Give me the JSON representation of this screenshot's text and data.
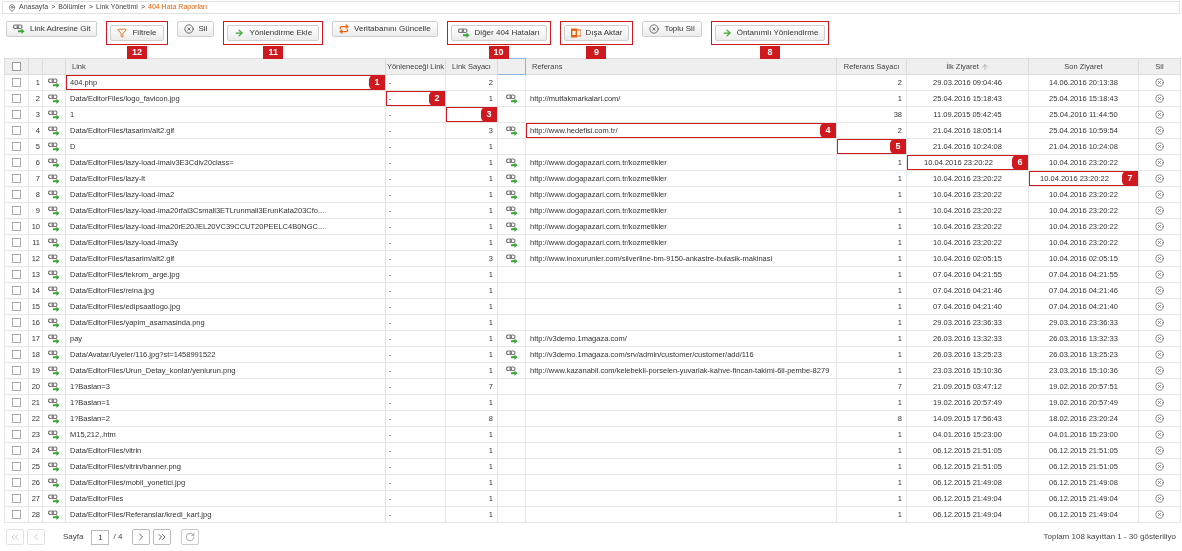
{
  "breadcrumb": {
    "separator": ">",
    "items": [
      {
        "label": "Anasayfa",
        "current": false
      },
      {
        "label": "Bölümler",
        "current": false
      },
      {
        "label": "Link Yönetimi",
        "current": false
      },
      {
        "label": "404 Hata Raporları",
        "current": true
      }
    ]
  },
  "toolbar": [
    {
      "label": "Link Adresine Git",
      "kind": "link"
    },
    {
      "label": "Filtrele",
      "kind": "filter",
      "callout": "12"
    },
    {
      "label": "Sil",
      "kind": "delete"
    },
    {
      "label": "Yönlendirme Ekle",
      "kind": "arrow",
      "callout": "11"
    },
    {
      "label": "Veritabanını Güncelle",
      "kind": "sync"
    },
    {
      "label": "Diğer 404 Hataları",
      "kind": "link",
      "callout": "10"
    },
    {
      "label": "Dışa Aktar",
      "kind": "office",
      "callout": "9"
    },
    {
      "label": "Toplu Sil",
      "kind": "delete"
    },
    {
      "label": "Öntanımlı Yönlendirme",
      "kind": "arrow",
      "callout": "8"
    }
  ],
  "table": {
    "header_checked": false,
    "columns": [
      {
        "label": "Link",
        "sorted": false
      },
      {
        "label": "Yönleneceği Link",
        "sorted": false
      },
      {
        "label": "Link Sayacı",
        "sorted": false
      },
      {
        "label": "Referans",
        "sorted": false
      },
      {
        "label": "Referans Sayacı",
        "sorted": false
      },
      {
        "label": "İlk Ziyaret",
        "sorted": true
      },
      {
        "label": "Son Ziyaret",
        "sorted": false
      },
      {
        "label": "Sil",
        "sorted": false
      }
    ],
    "rows": [
      {
        "n": "1",
        "checked": false,
        "link": "404.php",
        "redirect": "-",
        "count": "2",
        "ref_icon": false,
        "referer": "",
        "ref_count": "2",
        "first_visit": "29.03.2016 09:04:46",
        "last_visit": "14.06.2016 20:13:38",
        "link_callout": "1"
      },
      {
        "n": "2",
        "checked": false,
        "link": "Data/EditorFiles/logo_favicon.jpg",
        "redirect": "-",
        "count": "1",
        "ref_icon": true,
        "referer": "http://mutfakmarkalari.com/",
        "ref_count": "1",
        "first_visit": "25.04.2016 15:18:43",
        "last_visit": "25.04.2016 15:18:43",
        "redirect_callout": "2"
      },
      {
        "n": "3",
        "checked": false,
        "link": "1",
        "redirect": "-",
        "count": "",
        "ref_icon": false,
        "referer": "",
        "ref_count": "38",
        "first_visit": "11.09.2015 05:42:45",
        "last_visit": "25.04.2016 11:44:50",
        "count_callout": "3"
      },
      {
        "n": "4",
        "checked": false,
        "link": "Data/EditorFiles/tasarim/alt2.gif",
        "redirect": "-",
        "count": "3",
        "ref_icon": true,
        "referer": "http://www.hedefisi.com.tr/",
        "ref_count": "2",
        "first_visit": "21.04.2016 18:05:14",
        "last_visit": "25.04.2016 10:59:54",
        "referer_callout": "4"
      },
      {
        "n": "5",
        "checked": false,
        "link": "D",
        "redirect": "-",
        "count": "1",
        "ref_icon": false,
        "referer": "",
        "ref_count": "",
        "first_visit": "21.04.2016 10:24:08",
        "last_visit": "21.04.2016 10:24:08",
        "ref_count_callout": "5"
      },
      {
        "n": "6",
        "checked": false,
        "link": "Data/EditorFiles/lazy-load-imaiv3E3Cdiv20class=",
        "redirect": "-",
        "count": "1",
        "ref_icon": true,
        "referer": "http://www.dogapazari.com.tr/kozmetikler",
        "ref_count": "1",
        "first_visit": "10.04.2016 23:20:22",
        "last_visit": "10.04.2016 23:20:22",
        "first_visit_callout": "6"
      },
      {
        "n": "7",
        "checked": false,
        "link": "Data/EditorFiles/lazy-lt",
        "redirect": "-",
        "count": "1",
        "ref_icon": true,
        "referer": "http://www.dogapazari.com.tr/kozmetikler",
        "ref_count": "1",
        "first_visit": "10.04.2016 23:20:22",
        "last_visit": "10.04.2016 23:20:22",
        "last_visit_callout": "7"
      },
      {
        "n": "8",
        "checked": false,
        "link": "Data/EditorFiles/lazy-load-ima2",
        "redirect": "-",
        "count": "1",
        "ref_icon": true,
        "referer": "http://www.dogapazari.com.tr/kozmetikler",
        "ref_count": "1",
        "first_visit": "10.04.2016 23:20:22",
        "last_visit": "10.04.2016 23:20:22"
      },
      {
        "n": "9",
        "checked": false,
        "link": "Data/EditorFiles/lazy-load-ima20rfal3Csmall3ETLrunmall3ErunKata203Cfo...",
        "redirect": "-",
        "count": "1",
        "ref_icon": true,
        "referer": "http://www.dogapazari.com.tr/kozmetikler",
        "ref_count": "1",
        "first_visit": "10.04.2016 23:20:22",
        "last_visit": "10.04.2016 23:20:22"
      },
      {
        "n": "10",
        "checked": false,
        "link": "Data/EditorFiles/lazy-load-ima20rE20JEL20VC39CCUT20PEELC4B0NGC...",
        "redirect": "-",
        "count": "1",
        "ref_icon": true,
        "referer": "http://www.dogapazari.com.tr/kozmetikler",
        "ref_count": "1",
        "first_visit": "10.04.2016 23:20:22",
        "last_visit": "10.04.2016 23:20:22"
      },
      {
        "n": "11",
        "checked": false,
        "link": "Data/EditorFiles/lazy-load-ima3y",
        "redirect": "-",
        "count": "1",
        "ref_icon": true,
        "referer": "http://www.dogapazari.com.tr/kozmetikler",
        "ref_count": "1",
        "first_visit": "10.04.2016 23:20:22",
        "last_visit": "10.04.2016 23:20:22"
      },
      {
        "n": "12",
        "checked": false,
        "link": "Data/EditorFiles/tasarim/alt2.gif",
        "redirect": "-",
        "count": "3",
        "ref_icon": true,
        "referer": "http://www.inoxurunler.com/silverline-bm-9150-ankastre-bulasik-makinasi",
        "ref_count": "1",
        "first_visit": "10.04.2016 02:05:15",
        "last_visit": "10.04.2016 02:05:15"
      },
      {
        "n": "13",
        "checked": false,
        "link": "Data/EditorFiles/tekrom_arge.jpg",
        "redirect": "-",
        "count": "1",
        "ref_icon": false,
        "referer": "",
        "ref_count": "1",
        "first_visit": "07.04.2016 04:21:55",
        "last_visit": "07.04.2016 04:21:55"
      },
      {
        "n": "14",
        "checked": false,
        "link": "Data/EditorFiles/reina.jpg",
        "redirect": "-",
        "count": "1",
        "ref_icon": false,
        "referer": "",
        "ref_count": "1",
        "first_visit": "07.04.2016 04:21:46",
        "last_visit": "07.04.2016 04:21:46"
      },
      {
        "n": "15",
        "checked": false,
        "link": "Data/EditorFiles/edipsaatlogo.jpg",
        "redirect": "-",
        "count": "1",
        "ref_icon": false,
        "referer": "",
        "ref_count": "1",
        "first_visit": "07.04.2016 04:21:40",
        "last_visit": "07.04.2016 04:21:40"
      },
      {
        "n": "16",
        "checked": false,
        "link": "Data/EditorFiles/yapim_asamasinda.png",
        "redirect": "-",
        "count": "1",
        "ref_icon": false,
        "referer": "",
        "ref_count": "1",
        "first_visit": "29.03.2016 23:36:33",
        "last_visit": "29.03.2016 23:36:33"
      },
      {
        "n": "17",
        "checked": false,
        "link": "pay",
        "redirect": "-",
        "count": "1",
        "ref_icon": true,
        "referer": "http://v3demo.1magaza.com/",
        "ref_count": "1",
        "first_visit": "26.03.2016 13:32:33",
        "last_visit": "26.03.2016 13:32:33"
      },
      {
        "n": "18",
        "checked": false,
        "link": "Data/Avatar/Uyeler/116.jpg?st=1458991522",
        "redirect": "-",
        "count": "1",
        "ref_icon": true,
        "referer": "http://v3demo.1magaza.com/srv/admin/customer/customer/add/116",
        "ref_count": "1",
        "first_visit": "26.03.2016 13:25:23",
        "last_visit": "26.03.2016 13:25:23"
      },
      {
        "n": "19",
        "checked": false,
        "link": "Data/EditorFiles/Urun_Detay_konlar/yeniurun.png",
        "redirect": "-",
        "count": "1",
        "ref_icon": true,
        "referer": "http://www.kazanabil.com/kelebekli-porselen-yuvarlak-kahve-fincan-takimi-6li-pembe-8279",
        "ref_count": "1",
        "first_visit": "23.03.2016 15:10:36",
        "last_visit": "23.03.2016 15:10:36"
      },
      {
        "n": "20",
        "checked": false,
        "link": "1?Baslan=3",
        "redirect": "-",
        "count": "7",
        "ref_icon": false,
        "referer": "",
        "ref_count": "7",
        "first_visit": "21.09.2015 03:47:12",
        "last_visit": "19.02.2016 20:57:51"
      },
      {
        "n": "21",
        "checked": false,
        "link": "1?Baslan=1",
        "redirect": "-",
        "count": "1",
        "ref_icon": false,
        "referer": "",
        "ref_count": "1",
        "first_visit": "19.02.2016 20:57:49",
        "last_visit": "19.02.2016 20:57:49"
      },
      {
        "n": "22",
        "checked": false,
        "link": "1?Baslan=2",
        "redirect": "-",
        "count": "8",
        "ref_icon": false,
        "referer": "",
        "ref_count": "8",
        "first_visit": "14.09.2015 17:56:43",
        "last_visit": "18.02.2016 23:20:24"
      },
      {
        "n": "23",
        "checked": false,
        "link": "M15,212,.htm",
        "redirect": "-",
        "count": "1",
        "ref_icon": false,
        "referer": "",
        "ref_count": "1",
        "first_visit": "04.01.2016 15:23:00",
        "last_visit": "04.01.2016 15:23:00"
      },
      {
        "n": "24",
        "checked": false,
        "link": "Data/EditorFiles/vitrin",
        "redirect": "-",
        "count": "1",
        "ref_icon": false,
        "referer": "",
        "ref_count": "1",
        "first_visit": "06.12.2015 21:51:05",
        "last_visit": "06.12.2015 21:51:05"
      },
      {
        "n": "25",
        "checked": false,
        "link": "Data/EditorFiles/vitrin/banner.png",
        "redirect": "-",
        "count": "1",
        "ref_icon": false,
        "referer": "",
        "ref_count": "1",
        "first_visit": "06.12.2015 21:51:05",
        "last_visit": "06.12.2015 21:51:05"
      },
      {
        "n": "26",
        "checked": false,
        "link": "Data/EditorFiles/mobil_yonetici.jpg",
        "redirect": "-",
        "count": "1",
        "ref_icon": false,
        "referer": "",
        "ref_count": "1",
        "first_visit": "06.12.2015 21:49:08",
        "last_visit": "06.12.2015 21:49:08"
      },
      {
        "n": "27",
        "checked": false,
        "link": "Data/EditorFiles",
        "redirect": "-",
        "count": "1",
        "ref_icon": false,
        "referer": "",
        "ref_count": "1",
        "first_visit": "06.12.2015 21:49:04",
        "last_visit": "06.12.2015 21:49:04"
      },
      {
        "n": "28",
        "checked": false,
        "link": "Data/EditorFiles/Referanslar/kredi_kart.jpg",
        "redirect": "-",
        "count": "1",
        "ref_icon": false,
        "referer": "",
        "ref_count": "1",
        "first_visit": "06.12.2015 21:49:04",
        "last_visit": "06.12.2015 21:49:04"
      }
    ]
  },
  "pager": {
    "label": "Sayfa",
    "page": "1",
    "total": "/ 4",
    "first_disabled": true,
    "prev_disabled": true,
    "status": "Toplam 108 kayıttan 1 - 30 gösteriliyo"
  }
}
